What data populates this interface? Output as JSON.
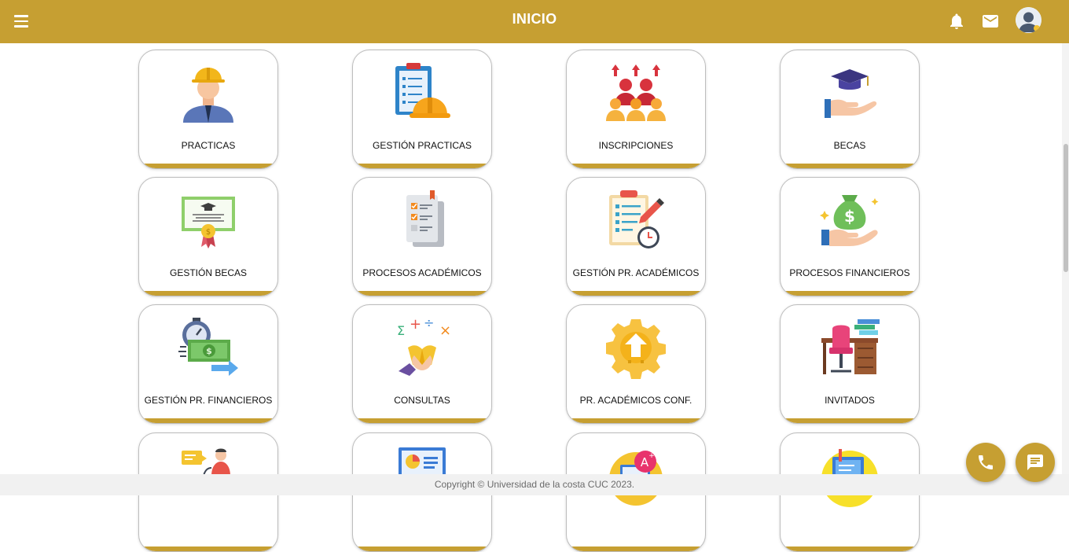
{
  "header": {
    "title": "INICIO",
    "menu_icon": "hamburger-menu-icon",
    "notification_icon": "bell-icon",
    "mail_icon": "envelope-icon",
    "avatar_icon": "user-avatar-icon"
  },
  "colors": {
    "brand": "#c69f32",
    "card_border": "#bdbdbd",
    "footer_bg": "#f1f1f1"
  },
  "cards": [
    {
      "label": "PRACTICAS",
      "icon": "worker-hardhat-icon"
    },
    {
      "label": "GESTIÓN PRACTICAS",
      "icon": "clipboard-hardhat-icon"
    },
    {
      "label": "INSCRIPCIONES",
      "icon": "people-up-arrows-icon"
    },
    {
      "label": "BECAS",
      "icon": "graduation-cap-hand-icon"
    },
    {
      "label": "GESTIÓN BECAS",
      "icon": "certificate-icon"
    },
    {
      "label": "PROCESOS ACADÉMICOS",
      "icon": "checklist-documents-icon"
    },
    {
      "label": "GESTIÓN PR. ACADÉMICOS",
      "icon": "clipboard-pencil-clock-icon"
    },
    {
      "label": "PROCESOS FINANCIEROS",
      "icon": "money-bag-hand-icon"
    },
    {
      "label": "GESTIÓN PR. FINANCIEROS",
      "icon": "stopwatch-banknote-icon"
    },
    {
      "label": "CONSULTAS",
      "icon": "math-symbols-book-icon"
    },
    {
      "label": "PR. ACADÉMICOS CONF.",
      "icon": "gear-upload-icon"
    },
    {
      "label": "INVITADOS",
      "icon": "desk-chair-books-icon"
    },
    {
      "label": "",
      "icon": "person-speech-bubble-icon"
    },
    {
      "label": "",
      "icon": "presentation-chart-icon"
    },
    {
      "label": "",
      "icon": "grade-a-plus-icon"
    },
    {
      "label": "",
      "icon": "folder-document-icon"
    }
  ],
  "footer": {
    "copyright": "Copyright © Universidad de la costa CUC 2023."
  },
  "fabs": {
    "phone_icon": "phone-icon",
    "chat_icon": "chat-icon"
  }
}
